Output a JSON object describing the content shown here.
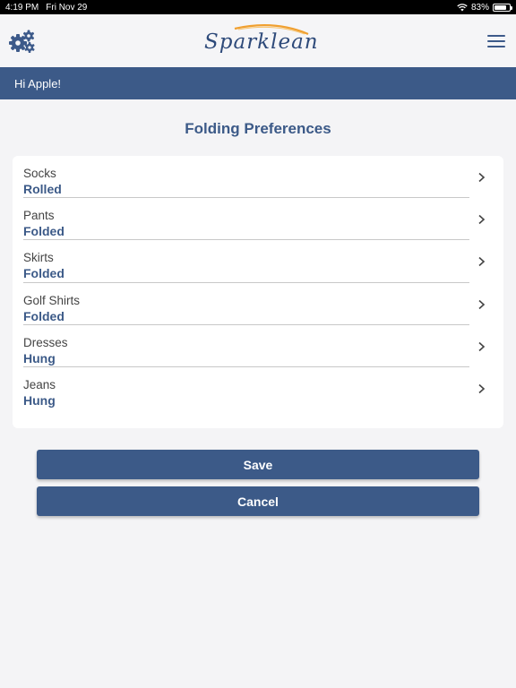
{
  "status_bar": {
    "time": "4:19 PM",
    "date": "Fri Nov 29",
    "battery_percent": "83%",
    "battery_level": 0.83,
    "wifi_icon": "wifi-icon"
  },
  "header": {
    "logo_text": "Sparklean",
    "settings_icon": "gears-icon",
    "menu_icon": "hamburger-menu-icon"
  },
  "greeting": "Hi Apple!",
  "page": {
    "title": "Folding Preferences"
  },
  "preferences": [
    {
      "label": "Socks",
      "value": "Rolled"
    },
    {
      "label": "Pants",
      "value": "Folded"
    },
    {
      "label": "Skirts",
      "value": "Folded"
    },
    {
      "label": "Golf Shirts",
      "value": "Folded"
    },
    {
      "label": "Dresses",
      "value": "Hung"
    },
    {
      "label": "Jeans",
      "value": "Hung"
    }
  ],
  "actions": {
    "save_label": "Save",
    "cancel_label": "Cancel"
  },
  "colors": {
    "brand_blue": "#3c5a88",
    "logo_swoosh": "#f0a030"
  }
}
